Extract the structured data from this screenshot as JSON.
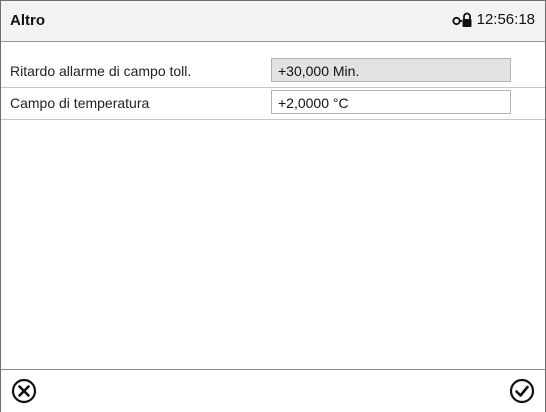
{
  "header": {
    "title": "Altro",
    "time": "12:56:18",
    "status_icon": "lock-key-icon"
  },
  "parameters": [
    {
      "label": "Ritardo allarme di campo toll.",
      "value": "+30,000 Min.",
      "editable": false
    },
    {
      "label": "Campo di temperatura",
      "value": "+2,0000 °C",
      "editable": true
    }
  ],
  "footer": {
    "cancel_icon": "close-circle-icon",
    "confirm_icon": "check-circle-icon"
  },
  "colors": {
    "header_bg": "#f3f3f3",
    "readonly_field_bg": "#e2e2e2",
    "border": "#6e6e6e"
  }
}
